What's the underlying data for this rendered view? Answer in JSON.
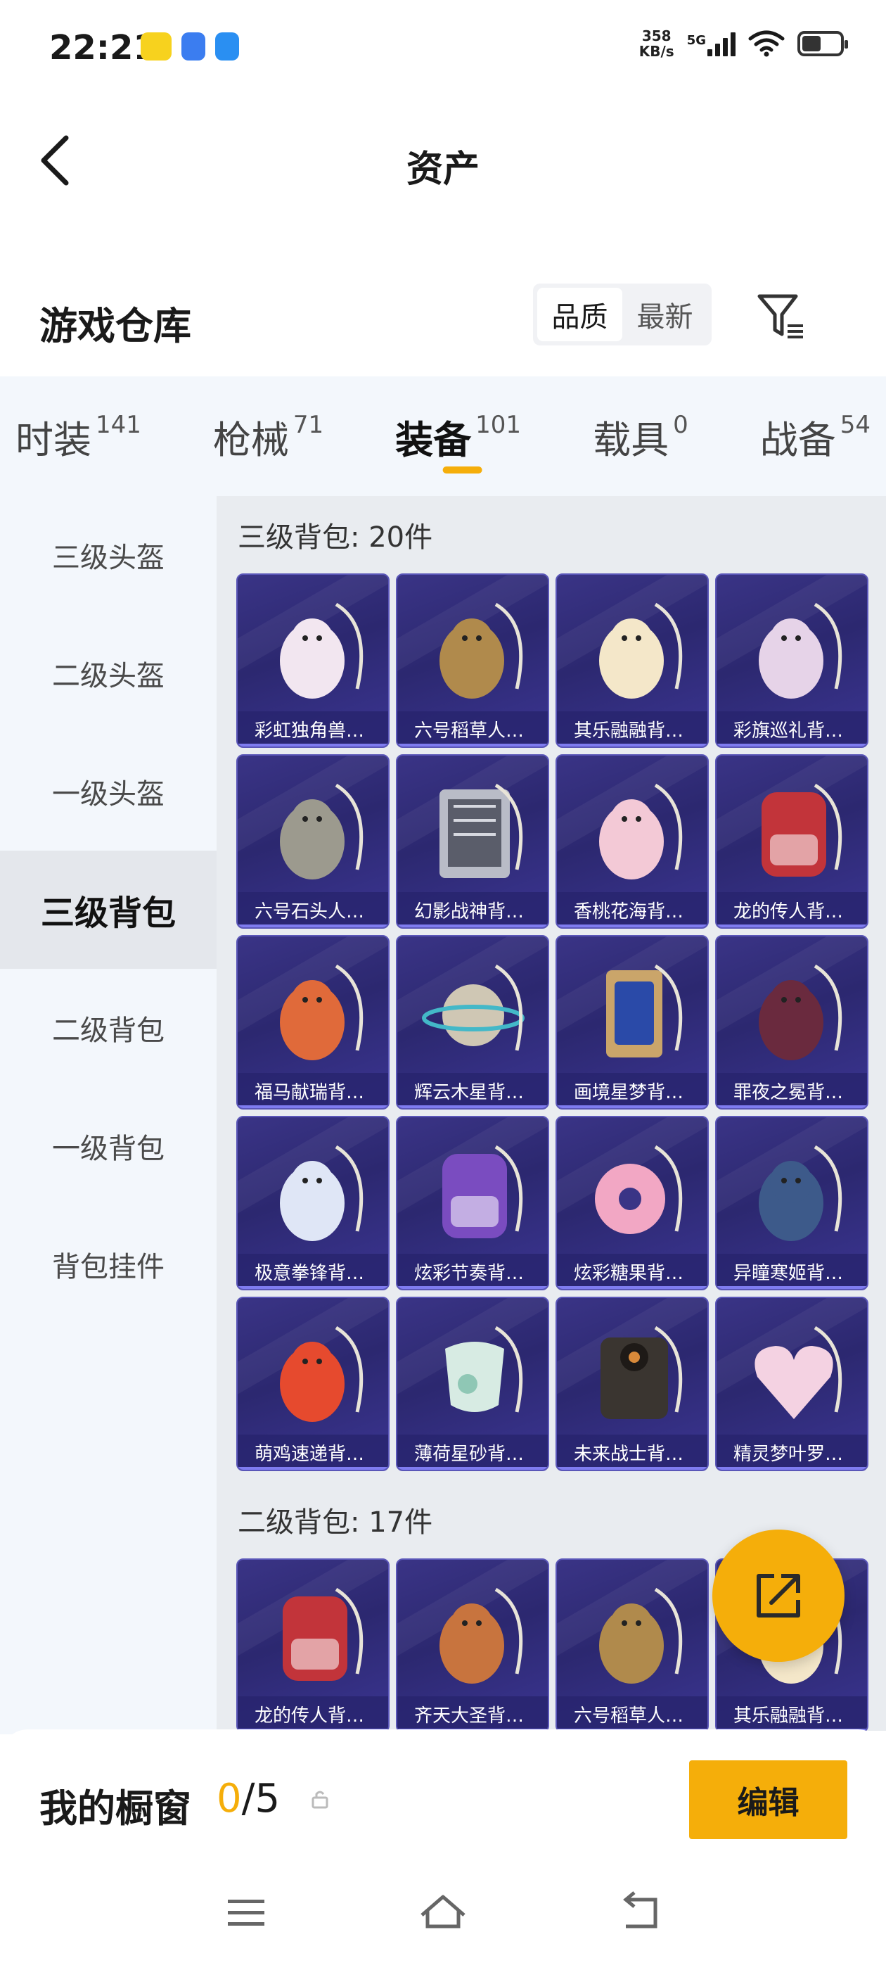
{
  "status_bar": {
    "time": "22:21",
    "net_speed_value": "358",
    "net_speed_unit": "KB/s",
    "signal": "5G"
  },
  "header": {
    "title": "资产"
  },
  "warehouse": {
    "title": "游戏仓库",
    "sort_options": [
      "品质",
      "最新"
    ],
    "sort_selected": "品质"
  },
  "tabs": [
    {
      "label": "时装",
      "count": "141",
      "active": false
    },
    {
      "label": "枪械",
      "count": "71",
      "active": false
    },
    {
      "label": "装备",
      "count": "101",
      "active": true
    },
    {
      "label": "载具",
      "count": "0",
      "active": false
    },
    {
      "label": "战备",
      "count": "54",
      "active": false
    }
  ],
  "side_nav": [
    {
      "label": "三级头盔",
      "active": false
    },
    {
      "label": "二级头盔",
      "active": false
    },
    {
      "label": "一级头盔",
      "active": false
    },
    {
      "label": "三级背包",
      "active": true
    },
    {
      "label": "二级背包",
      "active": false
    },
    {
      "label": "一级背包",
      "active": false
    },
    {
      "label": "背包挂件",
      "active": false
    }
  ],
  "sections": [
    {
      "title": "三级背包: 20件",
      "items": [
        {
          "name": "彩虹独角兽…",
          "art": "unicorn",
          "color": "#f2e6f0"
        },
        {
          "name": "六号稻草人…",
          "art": "scarecrow",
          "color": "#b08a4c"
        },
        {
          "name": "其乐融融背…",
          "art": "bunny",
          "color": "#f4e7c9"
        },
        {
          "name": "彩旗巡礼背…",
          "art": "shell",
          "color": "#e6d3e8"
        },
        {
          "name": "六号石头人…",
          "art": "stone",
          "color": "#9c9a8e"
        },
        {
          "name": "幻影战神背…",
          "art": "tech",
          "color": "#b9bcc7"
        },
        {
          "name": "香桃花海背…",
          "art": "dress",
          "color": "#f3c9d6"
        },
        {
          "name": "龙的传人背…",
          "art": "redpack",
          "color": "#c2343a"
        },
        {
          "name": "福马献瑞背…",
          "art": "horse",
          "color": "#e06a3a"
        },
        {
          "name": "辉云木星背…",
          "art": "planet",
          "color": "#cfc7b4"
        },
        {
          "name": "画境星梦背…",
          "art": "frame",
          "color": "#caa56a"
        },
        {
          "name": "罪夜之冕背…",
          "art": "dark",
          "color": "#6a2a3e"
        },
        {
          "name": "极意拳锋背…",
          "art": "cloud",
          "color": "#dfe6f6"
        },
        {
          "name": "炫彩节奏背…",
          "art": "purplepack",
          "color": "#7a4cc0"
        },
        {
          "name": "炫彩糖果背…",
          "art": "donut",
          "color": "#f2a7c4"
        },
        {
          "name": "异瞳寒姬背…",
          "art": "robot",
          "color": "#3d5a8a"
        },
        {
          "name": "萌鸡速递背…",
          "art": "chick",
          "color": "#e64a2e"
        },
        {
          "name": "薄荷星砂背…",
          "art": "bag",
          "color": "#d7ebe3"
        },
        {
          "name": "未来战士背…",
          "art": "mech",
          "color": "#3a3530"
        },
        {
          "name": "精灵梦叶罗…",
          "art": "heart",
          "color": "#f4d2e2"
        }
      ]
    },
    {
      "title": "二级背包: 17件",
      "items": [
        {
          "name": "龙的传人背…",
          "art": "redpack",
          "color": "#c2343a"
        },
        {
          "name": "齐天大圣背…",
          "art": "monkey",
          "color": "#c8743e"
        },
        {
          "name": "六号稻草人…",
          "art": "scarecrow",
          "color": "#b08a4c"
        },
        {
          "name": "其乐融融背…",
          "art": "bunny",
          "color": "#f4e7c9"
        }
      ]
    }
  ],
  "bottom": {
    "title": "我的橱窗",
    "current": "0",
    "sep_total": "/5",
    "edit_label": "编辑"
  },
  "colors": {
    "accent": "#f5ae0a",
    "card_bg": "#2c2870"
  }
}
